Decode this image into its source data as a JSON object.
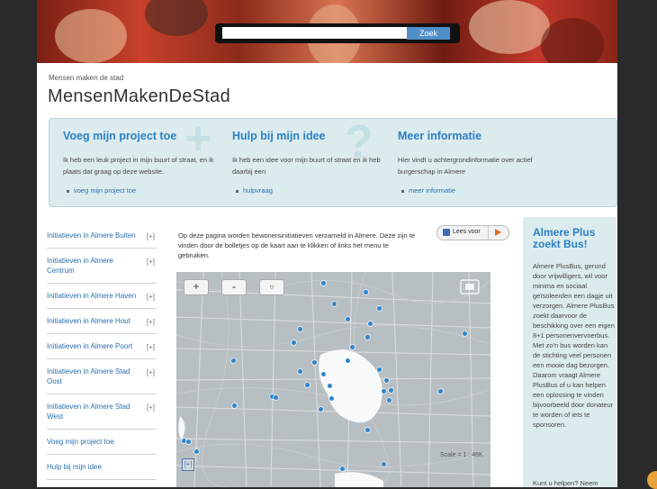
{
  "search": {
    "placeholder": "",
    "button": "Zoek"
  },
  "breadcrumb": "Mensen maken de stad",
  "page_title": "MensenMakenDeStad",
  "info": {
    "col1": {
      "title": "Voeg mijn project toe",
      "desc": "Ik heb een leuk project in mijn buurt of straat, en ik plaats dat graag op deze website.",
      "link": "voeg mijn project toe"
    },
    "col2": {
      "title": "Hulp bij mijn idee",
      "desc": "Ik heb een idee voor mijn buurt of straat en ik heb daarbij een",
      "link": "hulpvraag"
    },
    "col3": {
      "title": "Meer informatie",
      "desc": "Hier vindt u achtergrondinformatie over actief burgerschap in Almere",
      "link": "meer informatie"
    }
  },
  "sidebar": {
    "items": [
      {
        "label": "Initiatieven in Almere Buiten",
        "toggle": "[+]"
      },
      {
        "label": "Initiatieven in Almere Centrum",
        "toggle": "[+]"
      },
      {
        "label": "Initiatieven in Almere Haven",
        "toggle": "[+]"
      },
      {
        "label": "Initiatieven in Almere Hout",
        "toggle": "[+]"
      },
      {
        "label": "Initiatieven in Almere Poort",
        "toggle": "[+]"
      },
      {
        "label": "Initiatieven in Almere Stad Oost",
        "toggle": "[+]"
      },
      {
        "label": "Initiatieven in Almere Stad West",
        "toggle": "[+]"
      },
      {
        "label": "Voeg mijn project toe",
        "toggle": ""
      },
      {
        "label": "Hulp bij mijn idee",
        "toggle": ""
      }
    ]
  },
  "intro": "Op deze pagina worden bewonersinitiatieven verzameld in Almere. Deze zijn te vinden door de bolletjes op de kaart aan te klikken of links het menu te gebruiken.",
  "lees_voor": "Lees voor",
  "map": {
    "zoom_in": "+",
    "zoom_out": "-",
    "home": "○",
    "scale": "Scale = 1 : 46K",
    "overview": "[+]"
  },
  "rbox": {
    "title": "Almere Plus zoekt Bus!",
    "text": "Almere PlusBus, gerund door vrijwilligers, wil voor minima en sociaal geïsoleerden een dagje uit verzorgen. Almere PlusBus zoekt daarvoor de beschikking over een eigen 8+1 personenvervoerbus. Met zo'n bus worden kan de stichting veel personen een mooie dag bezorgen. Daarom vraagt Almere PlusBus of u kan helpen een oplossing te vinden bijvoorbeeld door donateur te worden of iets te sponsoren.",
    "cut": "Kunt u helpen? Neem"
  },
  "colors": {
    "accent": "#2b80c5",
    "panel": "#dcecee",
    "marker": "#2f86cc"
  }
}
